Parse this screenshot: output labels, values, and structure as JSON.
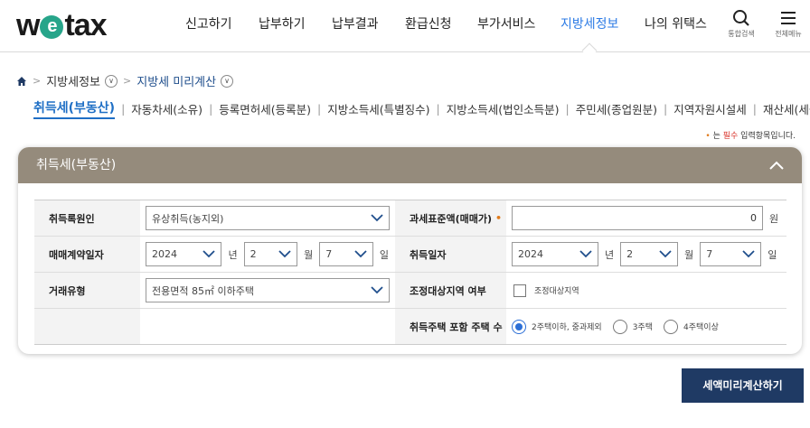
{
  "header": {
    "logo": "wetax",
    "nav": [
      "신고하기",
      "납부하기",
      "납부결과",
      "환급신청",
      "부가서비스",
      "지방세정보",
      "나의 위택스"
    ],
    "active_nav": "지방세정보",
    "search_label": "통합검색",
    "menu_label": "전체메뉴"
  },
  "breadcrumb": {
    "level1": "지방세정보",
    "level2": "지방세 미리계산"
  },
  "tabs": [
    "취득세(부동산)",
    "자동차세(소유)",
    "등록면허세(등록분)",
    "지방소득세(특별징수)",
    "지방소득세(법인소득분)",
    "주민세(종업원분)",
    "지역자원시설세",
    "재산세(세율특례)"
  ],
  "required_note": {
    "prefix": "는 ",
    "required": "필수",
    "suffix": " 입력항목입니다."
  },
  "panel": {
    "title": "취득세(부동산)",
    "acquisition_cause": {
      "label": "취득록원인",
      "value": "유상취득(농지외)"
    },
    "tax_base": {
      "label": "과세표준액(매매가)",
      "value": "0",
      "unit": "원"
    },
    "contract_date": {
      "label": "매매계약일자",
      "year": "2024",
      "month": "2",
      "day": "7"
    },
    "acquisition_date": {
      "label": "취득일자",
      "year": "2024",
      "month": "2",
      "day": "7"
    },
    "transaction_type": {
      "label": "거래유형",
      "value": "전용면적 85㎡ 이하주택"
    },
    "adjusted_area": {
      "label": "조정대상지역 여부",
      "checkbox_label": "조정대상지역"
    },
    "house_count": {
      "label": "취득주택 포함 주택 수",
      "options": [
        "2주택이하, 중과제외",
        "3주택",
        "4주택이상"
      ],
      "selected": "2주택이하, 중과제외"
    },
    "units": {
      "year": "년",
      "month": "월",
      "day": "일"
    }
  },
  "calc_button": "세액미리계산하기",
  "colors": {
    "panel_header": "#958b7c",
    "accent": "#2c7be5",
    "button": "#1f3a64"
  }
}
